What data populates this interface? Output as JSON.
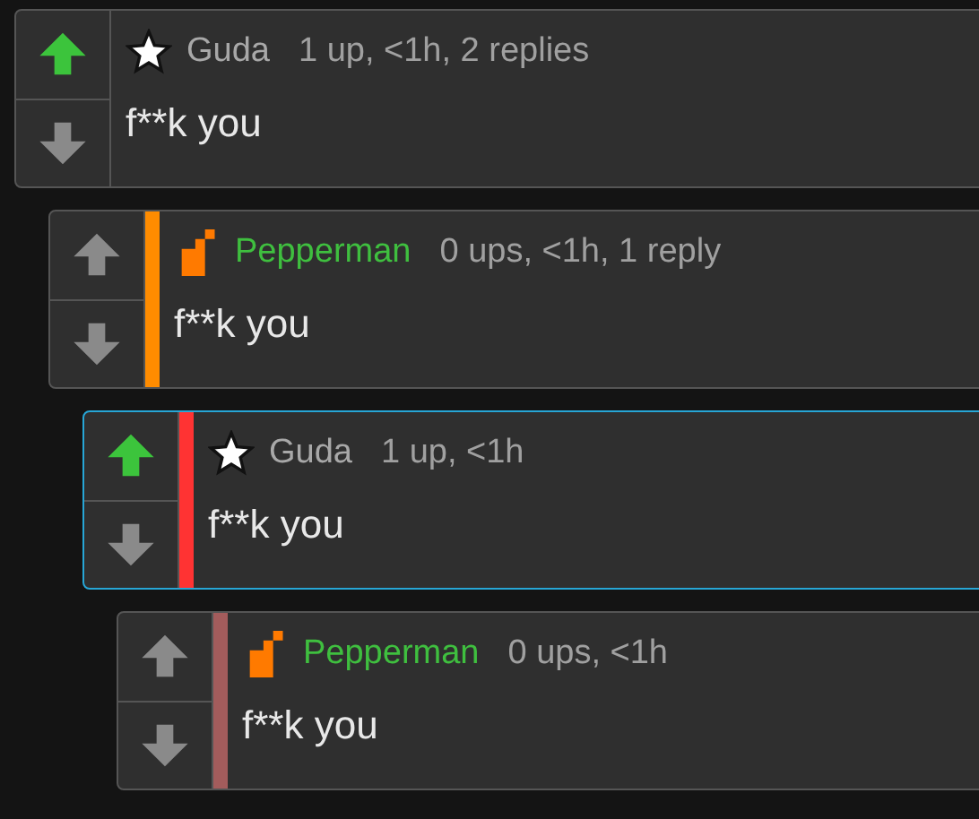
{
  "comments": [
    {
      "upvoted": true,
      "downvoted": false,
      "kind": "star",
      "user": "Guda",
      "meta": "1 up, <1h, 2 replies",
      "highlighted": false,
      "text": "f**k you",
      "children": [
        {
          "upvoted": false,
          "downvoted": false,
          "kind": "flag",
          "user": "Pepperman",
          "meta": "0 ups, <1h, 1 reply",
          "color": "#ff8c00",
          "highlighted": false,
          "text": "f**k you",
          "children": [
            {
              "upvoted": true,
              "downvoted": false,
              "kind": "star",
              "user": "Guda",
              "meta": "1 up, <1h",
              "color": "#ff3333",
              "highlighted": true,
              "text": "f**k you",
              "children": [
                {
                  "upvoted": false,
                  "downvoted": false,
                  "kind": "flag",
                  "user": "Pepperman",
                  "meta": "0 ups, <1h",
                  "color": "#a35c5c",
                  "highlighted": false,
                  "text": "f**k you"
                }
              ]
            }
          ]
        }
      ]
    }
  ]
}
